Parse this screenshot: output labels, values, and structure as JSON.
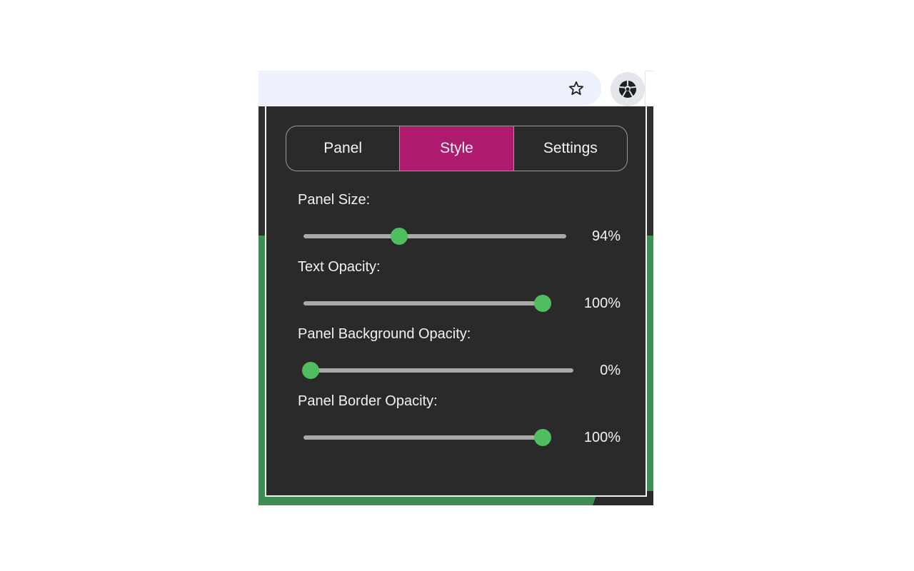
{
  "browser": {
    "bookmark_icon": "star-outline-icon",
    "extension_icon": "soccer-ball-icon"
  },
  "popup": {
    "tabs": [
      {
        "label": "Panel",
        "active": false
      },
      {
        "label": "Style",
        "active": true
      },
      {
        "label": "Settings",
        "active": false
      }
    ],
    "settings": [
      {
        "label": "Panel Size:",
        "value_text": "94%",
        "slider_position": 0.355
      },
      {
        "label": "Text Opacity:",
        "value_text": "100%",
        "slider_position": 1.0
      },
      {
        "label": "Panel Background Opacity:",
        "value_text": "0%",
        "slider_position": 0.0
      },
      {
        "label": "Panel Border Opacity:",
        "value_text": "100%",
        "slider_position": 1.0
      }
    ]
  },
  "colors": {
    "popup_background": "#2a2a2a",
    "active_tab": "#ad1a6e",
    "slider_thumb": "#4fbe5e",
    "slider_track": "#a9a9a9"
  }
}
